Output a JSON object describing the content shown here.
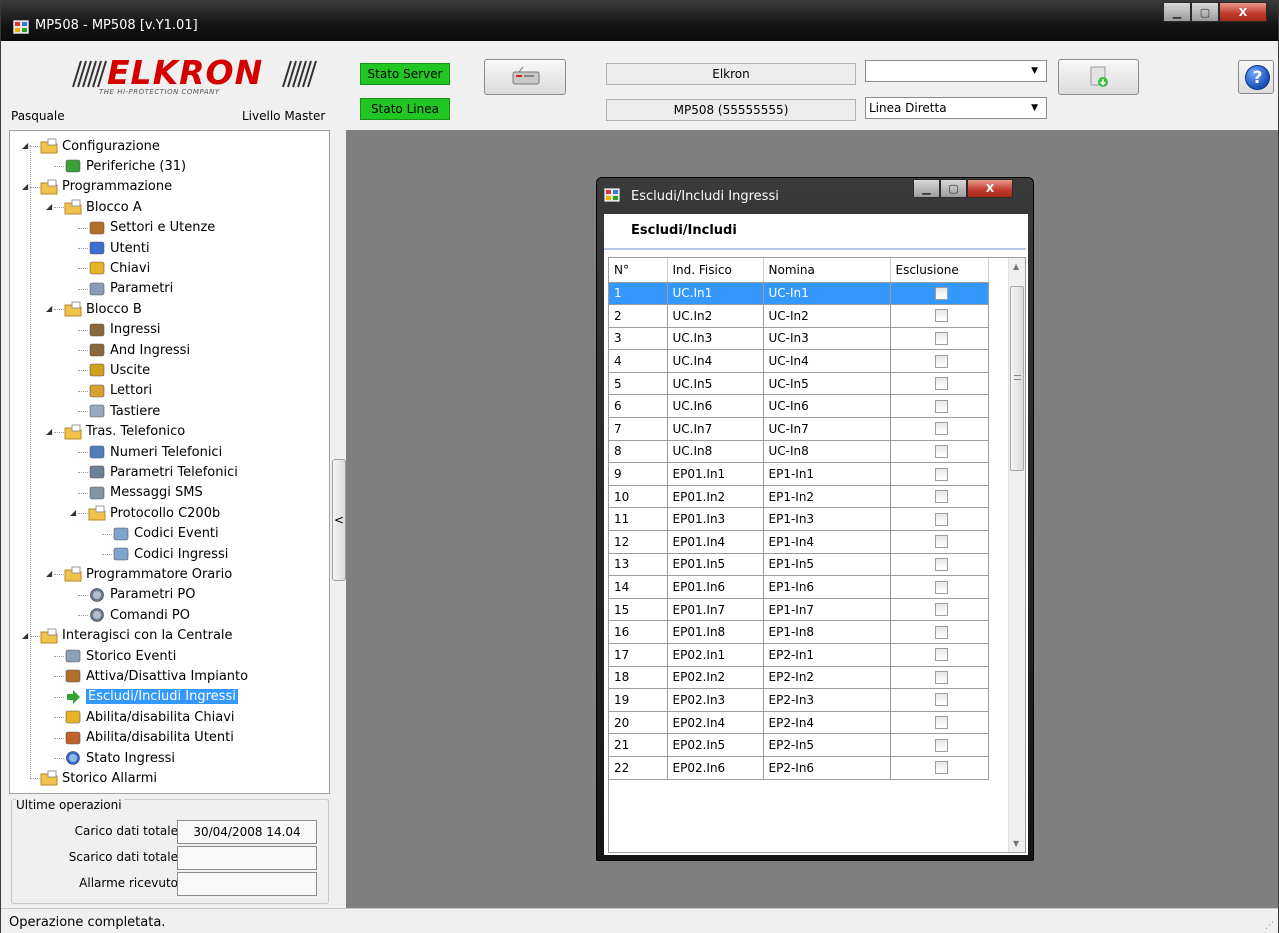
{
  "window": {
    "title": "MP508 - MP508 [v.Y1.01]",
    "caption_minimize": "▁",
    "caption_maximize": "▢",
    "caption_close": "X"
  },
  "header": {
    "logo_text": "ELKRON",
    "logo_tagline": "THE HI-PROTECTION COMPANY",
    "user": "Pasquale",
    "level": "Livello Master",
    "stato_server": "Stato Server",
    "stato_linea": "Stato Linea",
    "status_color": "#22c622",
    "site_name": "Elkron",
    "device": "MP508 (55555555)",
    "combo_top_value": "",
    "combo_line_value": "Linea Diretta",
    "help_label": "?"
  },
  "tree": [
    {
      "label": "Configurazione",
      "icon": "folder-config-icon"
    },
    {
      "label": "Periferiche (31)",
      "icon": "network-icon"
    },
    {
      "label": "Programmazione",
      "icon": "folder-edit-icon"
    },
    {
      "label": "Blocco A",
      "icon": "folder-edit-icon"
    },
    {
      "label": "Settori e Utenze",
      "icon": "house-icon"
    },
    {
      "label": "Utenti",
      "icon": "user-icon"
    },
    {
      "label": "Chiavi",
      "icon": "key-icon"
    },
    {
      "label": "Parametri",
      "icon": "hourglass-icon"
    },
    {
      "label": "Blocco B",
      "icon": "folder-edit-icon"
    },
    {
      "label": "Ingressi",
      "icon": "door-icon"
    },
    {
      "label": "And Ingressi",
      "icon": "door-icon"
    },
    {
      "label": "Uscite",
      "icon": "speaker-icon"
    },
    {
      "label": "Lettori",
      "icon": "reader-icon"
    },
    {
      "label": "Tastiere",
      "icon": "keyboard-icon"
    },
    {
      "label": "Tras. Telefonico",
      "icon": "folder-phone-icon"
    },
    {
      "label": "Numeri Telefonici",
      "icon": "phonebook-icon"
    },
    {
      "label": "Parametri Telefonici",
      "icon": "phone-icon"
    },
    {
      "label": "Messaggi SMS",
      "icon": "mobile-icon"
    },
    {
      "label": "Protocollo C200b",
      "icon": "folder-table-icon"
    },
    {
      "label": "Codici Eventi",
      "icon": "table-icon"
    },
    {
      "label": "Codici Ingressi",
      "icon": "table-icon"
    },
    {
      "label": "Programmatore Orario",
      "icon": "folder-clock-icon"
    },
    {
      "label": "Parametri PO",
      "icon": "clock-icon"
    },
    {
      "label": "Comandi PO",
      "icon": "clock-icon"
    },
    {
      "label": "Interagisci con la Centrale",
      "icon": "folder-arrow-icon"
    },
    {
      "label": "Storico Eventi",
      "icon": "log-icon"
    },
    {
      "label": "Attiva/Disattiva Impianto",
      "icon": "house-icon"
    },
    {
      "label": "Escludi/Includi Ingressi",
      "icon": "arrow-right-icon"
    },
    {
      "label": "Abilita/disabilita Chiavi",
      "icon": "key-group-icon"
    },
    {
      "label": "Abilita/disabilita Utenti",
      "icon": "users-icon"
    },
    {
      "label": "Stato Ingressi",
      "icon": "info-icon"
    },
    {
      "label": "Storico Allarmi",
      "icon": "folder-alarm-icon"
    }
  ],
  "last_ops": {
    "legend": "Ultime operazioni",
    "rows": [
      {
        "label": "Carico dati totale",
        "value": "30/04/2008 14.04"
      },
      {
        "label": "Scarico dati totale",
        "value": ""
      },
      {
        "label": "Allarme ricevuto",
        "value": ""
      }
    ]
  },
  "splitter_label": "<",
  "status_text": "Operazione completata.",
  "dialog": {
    "title": "Escludi/Includi Ingressi",
    "heading": "Escludi/Includi",
    "columns": [
      "N°",
      "Ind. Fisico",
      "Nomina",
      "Esclusione"
    ],
    "rows": [
      [
        "1",
        "UC.In1",
        "UC-In1"
      ],
      [
        "2",
        "UC.In2",
        "UC-In2"
      ],
      [
        "3",
        "UC.In3",
        "UC-In3"
      ],
      [
        "4",
        "UC.In4",
        "UC-In4"
      ],
      [
        "5",
        "UC.In5",
        "UC-In5"
      ],
      [
        "6",
        "UC.In6",
        "UC-In6"
      ],
      [
        "7",
        "UC.In7",
        "UC-In7"
      ],
      [
        "8",
        "UC.In8",
        "UC-In8"
      ],
      [
        "9",
        "EP01.In1",
        "EP1-In1"
      ],
      [
        "10",
        "EP01.In2",
        "EP1-In2"
      ],
      [
        "11",
        "EP01.In3",
        "EP1-In3"
      ],
      [
        "12",
        "EP01.In4",
        "EP1-In4"
      ],
      [
        "13",
        "EP01.In5",
        "EP1-In5"
      ],
      [
        "14",
        "EP01.In6",
        "EP1-In6"
      ],
      [
        "15",
        "EP01.In7",
        "EP1-In7"
      ],
      [
        "16",
        "EP01.In8",
        "EP1-In8"
      ],
      [
        "17",
        "EP02.In1",
        "EP2-In1"
      ],
      [
        "18",
        "EP02.In2",
        "EP2-In2"
      ],
      [
        "19",
        "EP02.In3",
        "EP2-In3"
      ],
      [
        "20",
        "EP02.In4",
        "EP2-In4"
      ],
      [
        "21",
        "EP02.In5",
        "EP2-In5"
      ],
      [
        "22",
        "EP02.In6",
        "EP2-In6"
      ]
    ],
    "selected_row": 0,
    "scroll_up": "▲",
    "scroll_down": "▼"
  }
}
